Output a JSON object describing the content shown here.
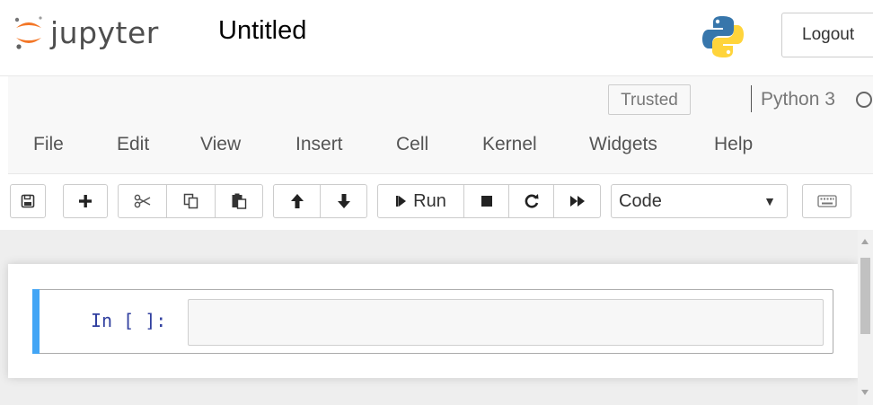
{
  "header": {
    "logo_text": "jupyter",
    "notebook_title": "Untitled",
    "logout_label": "Logout"
  },
  "status": {
    "trusted_label": "Trusted",
    "kernel_name": "Python 3"
  },
  "menu": {
    "items": [
      "File",
      "Edit",
      "View",
      "Insert",
      "Cell",
      "Kernel",
      "Widgets",
      "Help"
    ]
  },
  "toolbar": {
    "run_label": "Run",
    "cell_type_selected": "Code",
    "icons": [
      "save-icon",
      "plus-icon",
      "cut-icon",
      "copy-icon",
      "paste-icon",
      "arrow-up-icon",
      "arrow-down-icon",
      "step-forward-icon",
      "stop-icon",
      "restart-icon",
      "fast-forward-icon",
      "keyboard-icon"
    ]
  },
  "cell": {
    "prompt": "In [ ]:",
    "input_value": ""
  },
  "colors": {
    "accent_edge": "#42a5f5",
    "prompt": "#303f9f",
    "logo_orange": "#f37626",
    "python_blue": "#3776ab",
    "python_yellow": "#ffd43b"
  }
}
